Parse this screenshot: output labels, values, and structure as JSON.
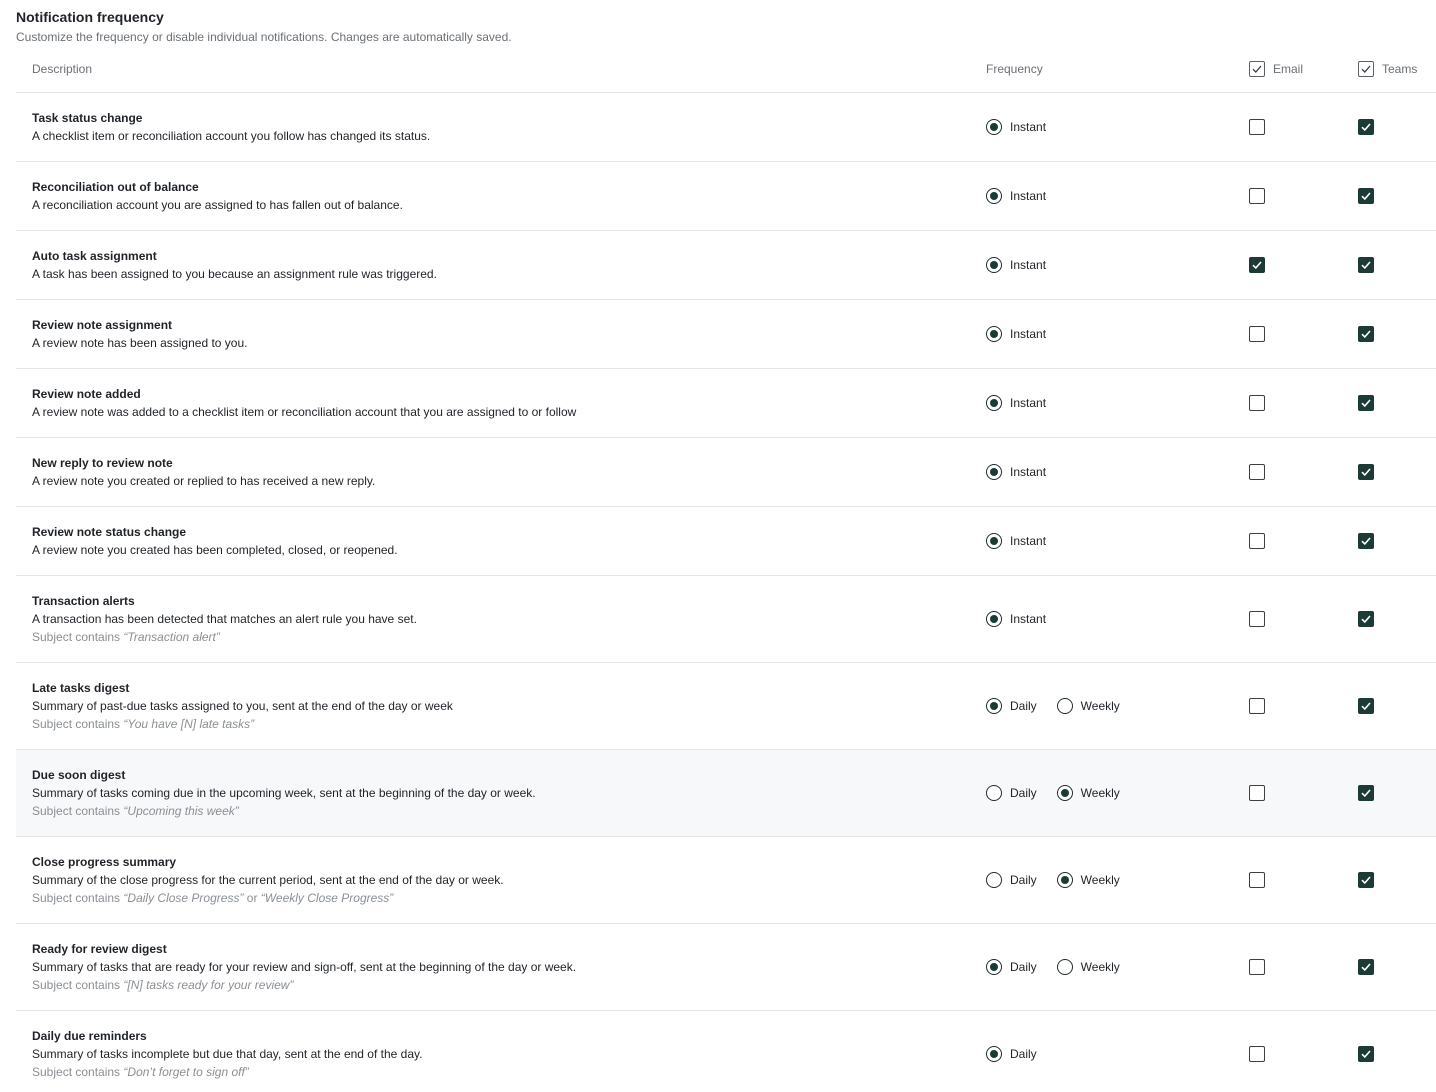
{
  "header": {
    "title": "Notification frequency",
    "subtitle": "Customize the frequency or disable individual notifications. Changes are automatically saved."
  },
  "columns": {
    "description": "Description",
    "frequency": "Frequency",
    "email": "Email",
    "teams": "Teams"
  },
  "rows": [
    {
      "name": "Task status change",
      "text": "A checklist item or reconciliation account you follow has changed its status.",
      "options": [
        {
          "label": "Instant",
          "selected": true
        }
      ],
      "email": false,
      "teams": true
    },
    {
      "name": "Reconciliation out of balance",
      "text": "A reconciliation account you are assigned to has fallen out of balance.",
      "options": [
        {
          "label": "Instant",
          "selected": true
        }
      ],
      "email": false,
      "teams": true
    },
    {
      "name": "Auto task assignment",
      "text": "A task has been assigned to you because an assignment rule was triggered.",
      "options": [
        {
          "label": "Instant",
          "selected": true
        }
      ],
      "email": true,
      "teams": true
    },
    {
      "name": "Review note assignment",
      "text": "A review note has been assigned to you.",
      "options": [
        {
          "label": "Instant",
          "selected": true
        }
      ],
      "email": false,
      "teams": true
    },
    {
      "name": "Review note added",
      "text": "A review note was added to a checklist item or reconciliation account that you are assigned to or follow",
      "options": [
        {
          "label": "Instant",
          "selected": true
        }
      ],
      "email": false,
      "teams": true
    },
    {
      "name": "New reply to review note",
      "text": "A review note you created or replied to has received a new reply.",
      "options": [
        {
          "label": "Instant",
          "selected": true
        }
      ],
      "email": false,
      "teams": true
    },
    {
      "name": "Review note status change",
      "text": "A review note you created has been completed, closed, or reopened.",
      "options": [
        {
          "label": "Instant",
          "selected": true
        }
      ],
      "email": false,
      "teams": true
    },
    {
      "name": "Transaction alerts",
      "text": "A transaction has been detected that matches an alert rule you have set.",
      "subject_prefix": "Subject contains",
      "subject_quote": "“Transaction alert”",
      "options": [
        {
          "label": "Instant",
          "selected": true
        }
      ],
      "email": false,
      "teams": true
    },
    {
      "name": "Late tasks digest",
      "text": "Summary of past-due tasks assigned to you, sent at the end of the day or week",
      "subject_prefix": "Subject contains",
      "subject_quote": "“You have [N] late tasks”",
      "options": [
        {
          "label": "Daily",
          "selected": true
        },
        {
          "label": "Weekly",
          "selected": false
        }
      ],
      "email": false,
      "teams": true
    },
    {
      "name": "Due soon digest",
      "text": "Summary of tasks coming due in the upcoming week, sent at the beginning of the day or week.",
      "subject_prefix": "Subject contains",
      "subject_quote": "“Upcoming this week”",
      "options": [
        {
          "label": "Daily",
          "selected": false
        },
        {
          "label": "Weekly",
          "selected": true
        }
      ],
      "email": false,
      "teams": true,
      "highlight": true
    },
    {
      "name": "Close progress summary",
      "text": "Summary of the close progress for the current period, sent at the end of the day or week.",
      "subject_prefix": "Subject contains",
      "subject_quote": "“Daily Close Progress”",
      "subject_join": "or",
      "subject_quote2": "“Weekly Close Progress”",
      "options": [
        {
          "label": "Daily",
          "selected": false
        },
        {
          "label": "Weekly",
          "selected": true
        }
      ],
      "email": false,
      "teams": true
    },
    {
      "name": "Ready for review digest",
      "text": "Summary of tasks that are ready for your review and sign-off, sent at the beginning of the day or week.",
      "subject_prefix": "Subject contains",
      "subject_quote": "“[N] tasks ready for your review”",
      "options": [
        {
          "label": "Daily",
          "selected": true
        },
        {
          "label": "Weekly",
          "selected": false
        }
      ],
      "email": false,
      "teams": true
    },
    {
      "name": "Daily due reminders",
      "text": "Summary of tasks incomplete but due that day, sent at the end of the day.",
      "subject_prefix": "Subject contains",
      "subject_quote": "“Don’t forget to sign off”",
      "options": [
        {
          "label": "Daily",
          "selected": true
        }
      ],
      "email": false,
      "teams": true
    }
  ],
  "colors": {
    "accent": "#1d3b36",
    "border": "#e3e5e7",
    "muted_text": "#6b7075",
    "highlight_row": "#f6f8fa"
  },
  "icons": {
    "checkbox_checked": "check-icon"
  }
}
